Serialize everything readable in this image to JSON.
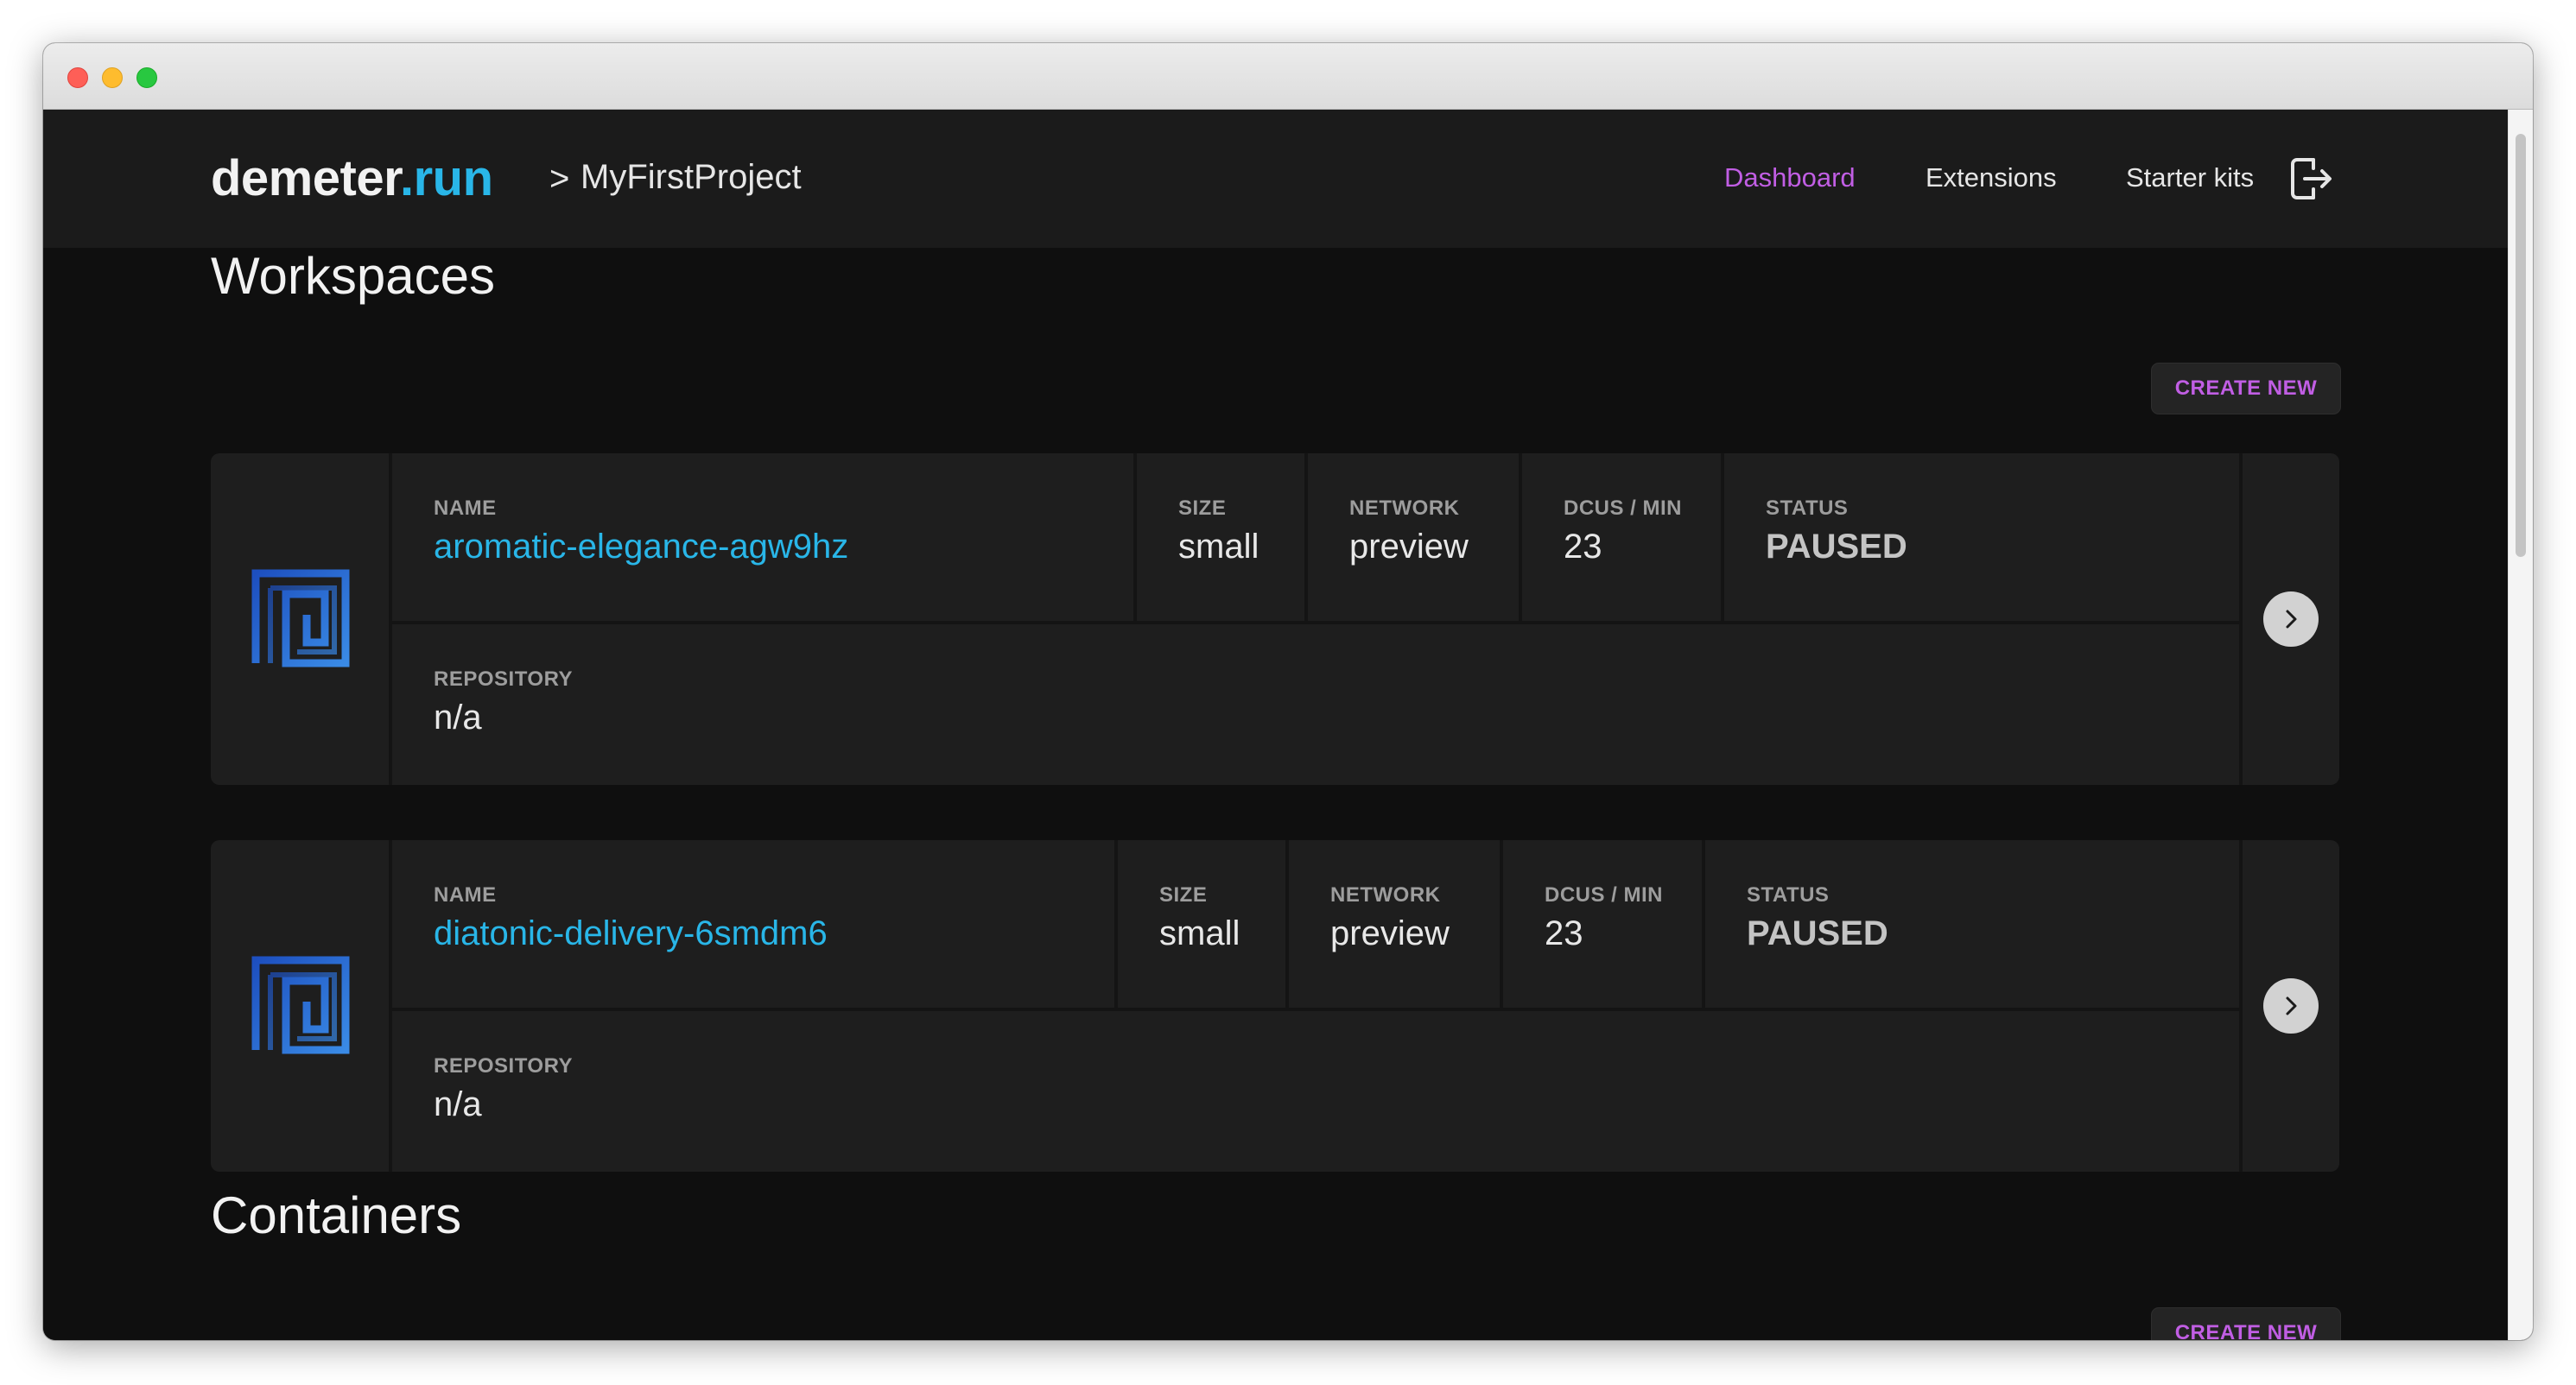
{
  "navbar": {
    "brand_name": "demeter",
    "brand_ext": ".run",
    "breadcrumb_separator": ">",
    "project": "MyFirstProject",
    "links": [
      "Dashboard",
      "Extensions",
      "Starter kits"
    ],
    "active_link": "Dashboard",
    "logout_icon": "logout-icon"
  },
  "workspaces": {
    "title": "Workspaces",
    "create_label": "CREATE NEW",
    "labels": {
      "name": "NAME",
      "size": "SIZE",
      "network": "NETWORK",
      "dcus": "DCUS / MIN",
      "status": "STATUS",
      "repository": "REPOSITORY"
    },
    "items": [
      {
        "name": "aromatic-elegance-agw9hz",
        "size": "small",
        "network": "preview",
        "dcus": "23",
        "status": "PAUSED",
        "repository": "n/a"
      },
      {
        "name": "diatonic-delivery-6smdm6",
        "size": "small",
        "network": "preview",
        "dcus": "23",
        "status": "PAUSED",
        "repository": "n/a"
      }
    ]
  },
  "containers": {
    "title": "Containers",
    "create_label": "CREATE NEW"
  },
  "colors": {
    "accent_purple": "#c15ee4",
    "accent_blue": "#29b6e8",
    "background": "#0f0f0f",
    "card": "#1e1e1e"
  }
}
